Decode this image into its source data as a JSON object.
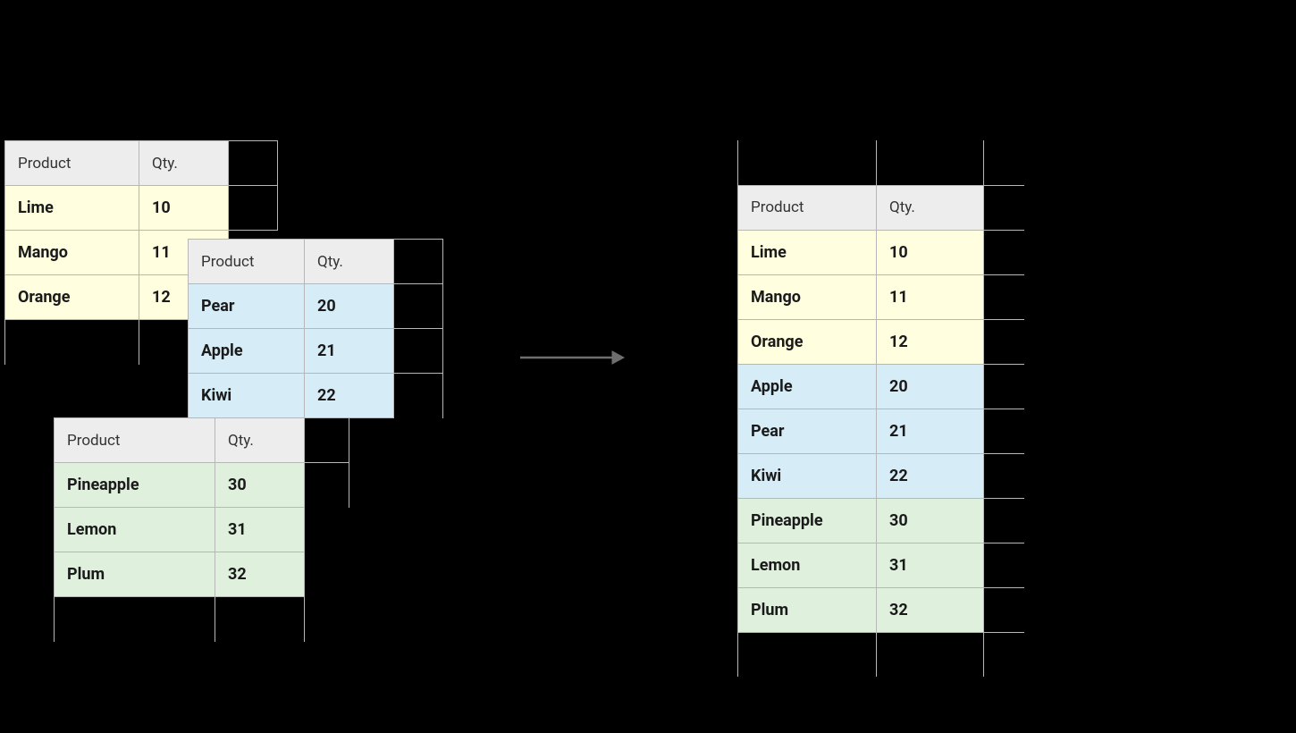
{
  "cols": {
    "product": "Product",
    "qty": "Qty."
  },
  "source": {
    "t1": {
      "tint": "yellow",
      "rows": [
        {
          "product": "Lime",
          "qty": "10"
        },
        {
          "product": "Mango",
          "qty": "11"
        },
        {
          "product": "Orange",
          "qty": "12"
        }
      ]
    },
    "t2": {
      "tint": "blue",
      "rows": [
        {
          "product": "Pear",
          "qty": "20"
        },
        {
          "product": "Apple",
          "qty": "21"
        },
        {
          "product": "Kiwi",
          "qty": "22"
        }
      ]
    },
    "t3": {
      "tint": "green",
      "rows": [
        {
          "product": "Pineapple",
          "qty": "30"
        },
        {
          "product": "Lemon",
          "qty": "31"
        },
        {
          "product": "Plum",
          "qty": "32"
        }
      ]
    }
  },
  "merged": [
    {
      "tint": "yellow",
      "product": "Lime",
      "qty": "10"
    },
    {
      "tint": "yellow",
      "product": "Mango",
      "qty": "11"
    },
    {
      "tint": "yellow",
      "product": "Orange",
      "qty": "12"
    },
    {
      "tint": "blue",
      "product": "Apple",
      "qty": "20"
    },
    {
      "tint": "blue",
      "product": "Pear",
      "qty": "21"
    },
    {
      "tint": "blue",
      "product": "Kiwi",
      "qty": "22"
    },
    {
      "tint": "green",
      "product": "Pineapple",
      "qty": "30"
    },
    {
      "tint": "green",
      "product": "Lemon",
      "qty": "31"
    },
    {
      "tint": "green",
      "product": "Plum",
      "qty": "32"
    }
  ]
}
